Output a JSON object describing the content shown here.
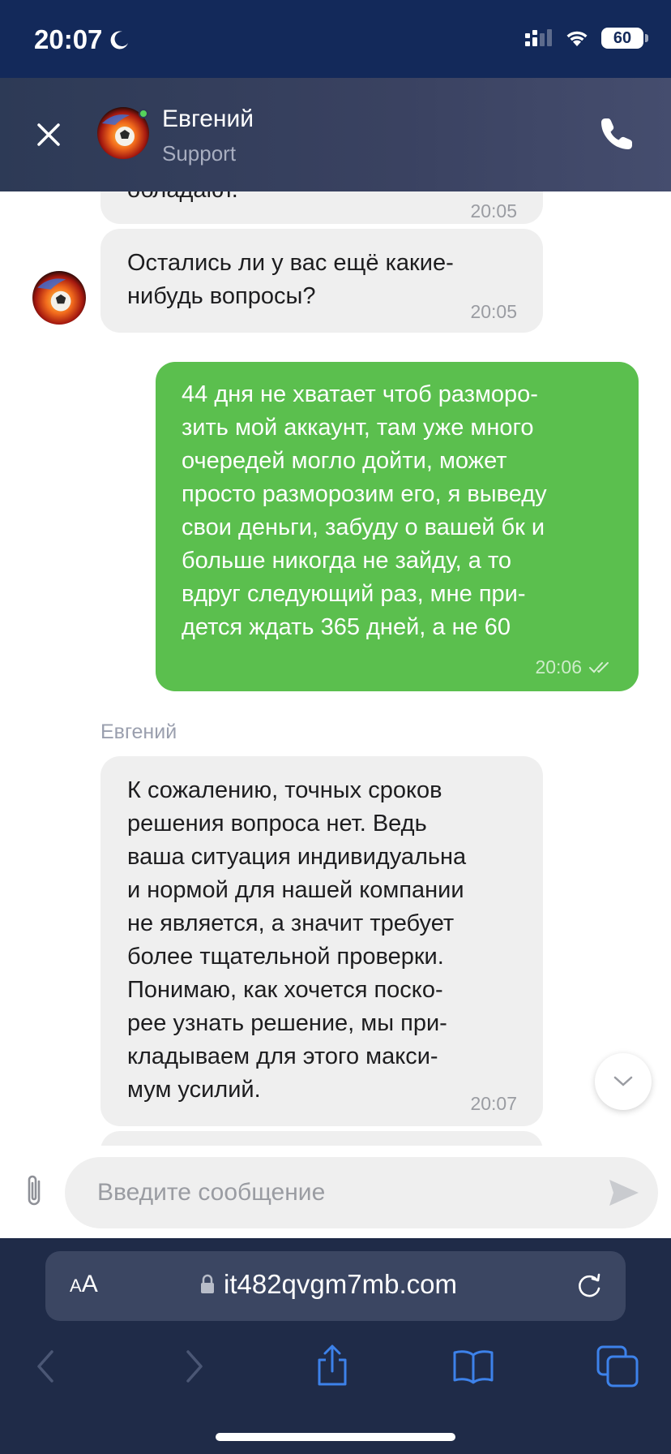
{
  "status_bar": {
    "time": "20:07",
    "battery": "60"
  },
  "header": {
    "name": "Евгений",
    "role": "Support"
  },
  "messages": [
    {
      "direction": "in",
      "text": "обладают.",
      "time": "20:05"
    },
    {
      "direction": "in",
      "text": "Остались ли у вас ещё какие-\nнибудь вопросы?",
      "time": "20:05"
    },
    {
      "direction": "out",
      "text": "44 дня не хватает чтоб разморо-\nзить мой аккаунт, там уже много\nочередей могло дойти, может\nпросто разморозим его, я выведу\nсвои деньги, забуду о вашей бк и\nбольше никогда не зайду, а то\nвдруг следующий раз, мне при-\nдется ждать 365 дней, а не 60",
      "time": "20:06",
      "read": true
    },
    {
      "direction": "in",
      "sender": "Евгений",
      "text": "К сожалению, точных сроков\nрешения вопроса нет. Ведь\nваша ситуация индивидуальна\nи нормой для нашей компании\nне является, а значит требует\nболее тщательной проверки.\nПонимаю, как хочется поско-\nрее узнать решение, мы при-\nкладываем для этого макси-\nмум усилий.",
      "time": "20:07"
    }
  ],
  "composer": {
    "placeholder": "Введите сообщение"
  },
  "browser": {
    "aa_label_small": "A",
    "aa_label_large": "A",
    "url": "it482qvgm7mb.com"
  },
  "colors": {
    "status_bar_bg": "#13295a",
    "header_bg": "#3a4261",
    "incoming_bubble": "#efefef",
    "outgoing_bubble": "#5bbf4e",
    "online": "#55d35b",
    "browser_bg": "#1f2b48",
    "browser_accent": "#3d82ea"
  },
  "icons": {
    "close": "close-icon",
    "call": "phone-icon",
    "attach": "paperclip-icon",
    "send": "send-icon",
    "scroll_down": "chevron-down-icon",
    "lock": "lock-icon",
    "reload": "reload-icon",
    "back": "back-arrow-icon",
    "forward": "forward-arrow-icon",
    "share": "share-icon",
    "bookmarks": "book-icon",
    "tabs": "tabs-icon"
  }
}
